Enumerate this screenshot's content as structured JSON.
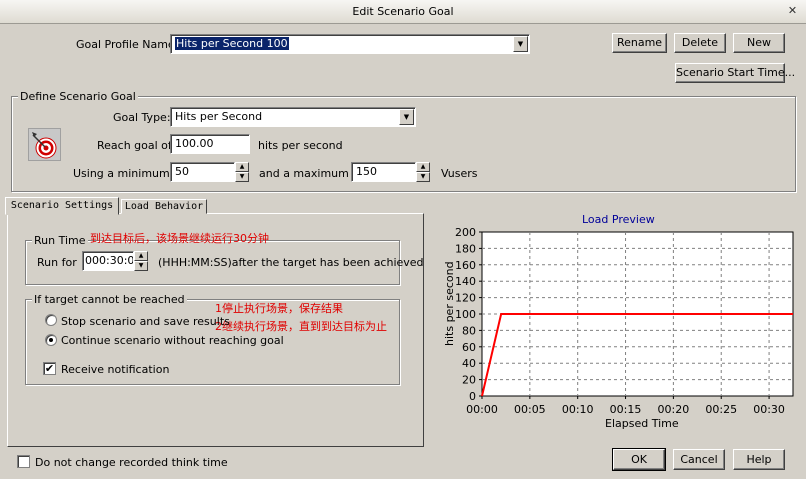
{
  "window": {
    "title": "Edit Scenario Goal",
    "close_glyph": "✕"
  },
  "goal_profile": {
    "label": "Goal Profile Name:",
    "value": "Hits per Second 100"
  },
  "buttons": {
    "rename": "Rename",
    "delete": "Delete",
    "new": "New",
    "scenario_start_time": "Scenario Start Time...",
    "ok": "OK",
    "cancel": "Cancel",
    "help": "Help"
  },
  "define_goal": {
    "group_title": "Define Scenario Goal",
    "goal_type_label": "Goal Type:",
    "goal_type_value": "Hits per Second",
    "reach_goal_label": "Reach goal of",
    "reach_goal_value": "100.00",
    "reach_goal_unit": "hits per second",
    "min_label": "Using a minimum of",
    "min_value": "50",
    "max_label": "and a maximum of",
    "max_value": "150",
    "vusers_label": "Vusers",
    "icon": "target-icon"
  },
  "tabs": [
    "Scenario Settings",
    "Load Behavior"
  ],
  "run_time": {
    "group_title": "Run Time",
    "run_for_label": "Run for",
    "run_for_value": "000:30:00",
    "format_text": "(HHH:MM:SS)after the target has been achieved"
  },
  "target_unreached": {
    "group_title": "If target cannot be reached",
    "option_stop": "Stop scenario and save results",
    "option_continue": "Continue scenario without reaching goal",
    "selected": "continue",
    "notify_label": "Receive notification",
    "notify_checked": true
  },
  "annotations": {
    "runtime_note": "到达目标后，该场景继续运行30分钟",
    "option1_note": "1停止执行场景，保存结果",
    "option2_note": "2继续执行场景，直到到达目标为止"
  },
  "footer": {
    "dont_change_think_time": "Do not change recorded think time",
    "dont_change_checked": false
  },
  "colors": {
    "line": "#ff0000",
    "chart_title": "#000099",
    "annotation": "#e00000",
    "selection": "#0a246a"
  },
  "chart_data": {
    "type": "line",
    "title": "Load Preview",
    "xlabel": "Elapsed Time",
    "ylabel": "hits per second",
    "x_ticks": [
      "00:00",
      "00:05",
      "00:10",
      "00:15",
      "00:20",
      "00:25",
      "00:30"
    ],
    "y_ticks": [
      0,
      20,
      40,
      60,
      80,
      100,
      120,
      140,
      160,
      180,
      200
    ],
    "xlim_minutes": [
      0,
      32.5
    ],
    "ylim": [
      0,
      200
    ],
    "grid": true,
    "series": [
      {
        "x_minutes": [
          0,
          2,
          32.5
        ],
        "y": [
          0,
          100,
          100
        ]
      }
    ]
  }
}
